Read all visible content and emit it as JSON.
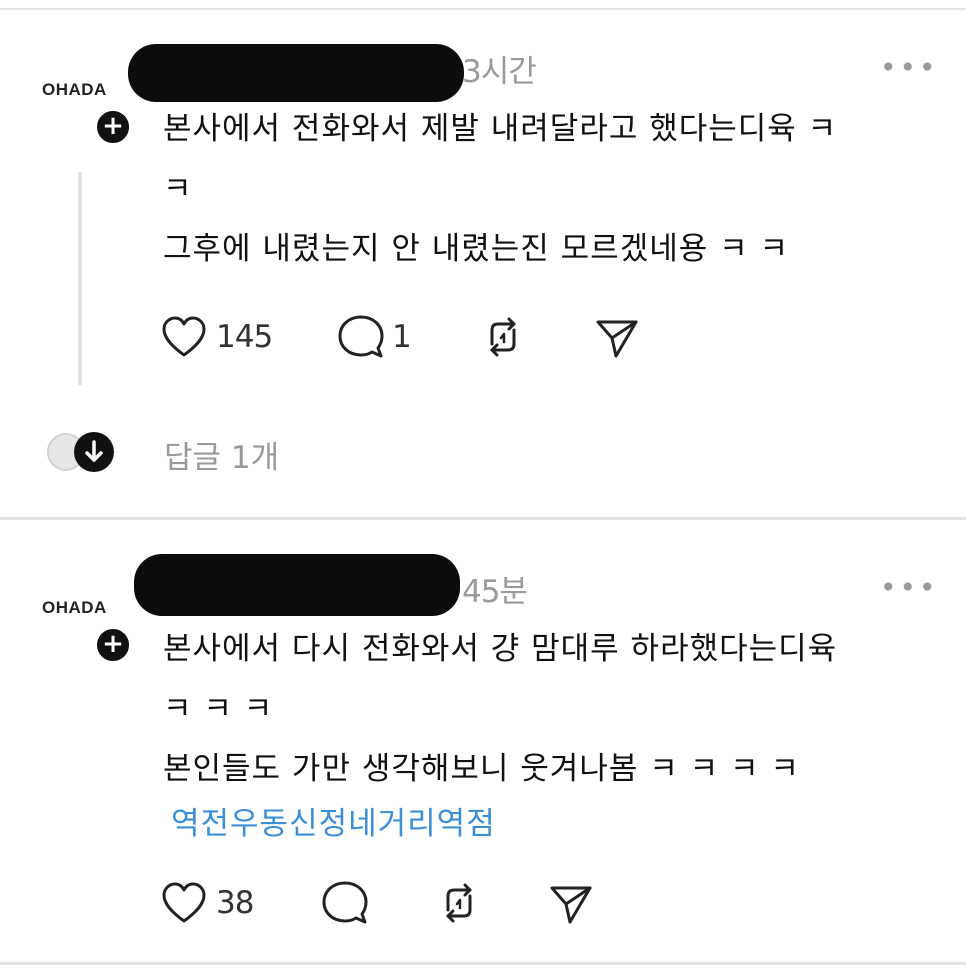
{
  "posts": [
    {
      "author_logo": "OHADA",
      "author_name": "",
      "time": "3시간",
      "lines": [
        "본사에서 전화와서 제발 내려달라고 했다는디육 ㅋ",
        "ㅋ",
        "그후에 내렸는지 안 내렸는진 모르겠네용 ㅋ ㅋ"
      ],
      "tag": "",
      "likes": "145",
      "comments": "1",
      "reposts": "",
      "replies_label": "답글 1개"
    },
    {
      "author_logo": "OHADA",
      "author_name": "",
      "time": "45분",
      "lines": [
        "본사에서 다시 전화와서 걍 맘대루 하라했다는디육",
        "ㅋ ㅋ ㅋ",
        "본인들도 가만 생각해보니 웃겨나봄 ㅋ ㅋ ㅋ ㅋ"
      ],
      "tag": "역전우동신정네거리역점",
      "likes": "38",
      "comments": "",
      "reposts": ""
    }
  ],
  "icons": {
    "more": "more-horizontal-icon",
    "follow": "plus-icon",
    "like": "heart-icon",
    "comment": "comment-bubble-icon",
    "repost": "repost-icon",
    "share": "send-icon",
    "expand": "arrow-down-icon"
  },
  "colors": {
    "text": "#111111",
    "muted": "#9a9a9a",
    "link": "#3b8fd6",
    "separator": "#e4e4e4"
  }
}
